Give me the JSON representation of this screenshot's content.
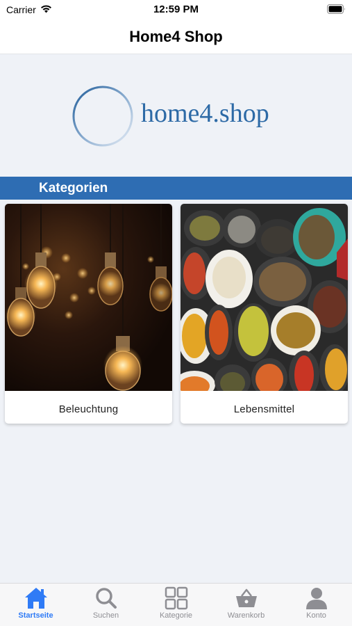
{
  "status_bar": {
    "carrier": "Carrier",
    "time": "12:59 PM"
  },
  "nav": {
    "title": "Home4 Shop"
  },
  "logo": {
    "text": "home4.shop"
  },
  "section": {
    "title": "Kategorien"
  },
  "categories": [
    {
      "label": "Beleuchtung",
      "image": "light-bulbs"
    },
    {
      "label": "Lebensmittel",
      "image": "spices"
    }
  ],
  "tabs": [
    {
      "label": "Startseite",
      "icon": "home-icon",
      "active": true
    },
    {
      "label": "Suchen",
      "icon": "search-icon",
      "active": false
    },
    {
      "label": "Kategorie",
      "icon": "grid-icon",
      "active": false
    },
    {
      "label": "Warenkorb",
      "icon": "basket-icon",
      "active": false
    },
    {
      "label": "Konto",
      "icon": "person-icon",
      "active": false
    }
  ],
  "colors": {
    "accent": "#2e6db3",
    "tab_active": "#2f7bf6",
    "tab_inactive": "#8e8e93",
    "logo": "#2d6aa6"
  }
}
